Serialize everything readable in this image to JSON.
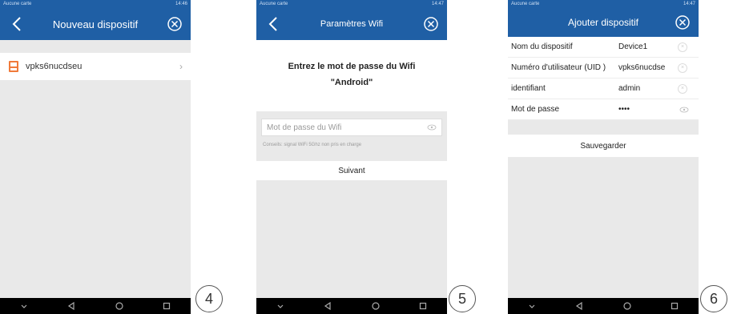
{
  "phones": [
    {
      "status_left": "Aucune carte",
      "status_right": "14:46",
      "title": "Nouveau dispositif",
      "device_item": {
        "name": "vpks6nucdseu",
        "icon": "device-icon"
      },
      "step": "4"
    },
    {
      "status_left": "Aucune carte",
      "status_right": "14:47",
      "title": "Paramètres Wifi",
      "prompt_line1": "Entrez le mot de passe du Wifi",
      "prompt_line2": "\"Android\"",
      "password_placeholder": "Mot de passe du Wifi",
      "hint": "Conseils: signal WiFi 5Ghz non pris en charge",
      "next_label": "Suivant",
      "step": "5"
    },
    {
      "status_left": "Aucune carte",
      "status_right": "14:47",
      "title": "Ajouter dispositif",
      "fields": [
        {
          "label": "Nom du dispositif",
          "value": "Device1"
        },
        {
          "label": "Numéro d'utilisateur (UID )",
          "value": "vpks6nucdse"
        },
        {
          "label": "identifiant",
          "value": "admin"
        },
        {
          "label": "Mot de passe",
          "value": "••••"
        }
      ],
      "save_label": "Sauvegarder",
      "step": "6"
    }
  ],
  "colors": {
    "header": "#1f5fa5",
    "background": "#e9e9e9",
    "navbar": "#000000"
  }
}
